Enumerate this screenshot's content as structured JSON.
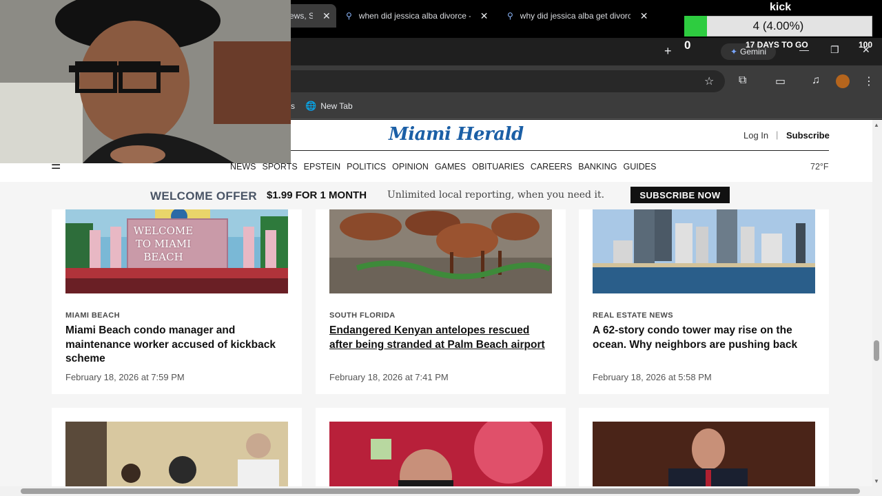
{
  "browser": {
    "tabs": [
      {
        "title": "ews, S",
        "active": true
      },
      {
        "title": "when did jessica alba divorce -",
        "active": false
      },
      {
        "title": "why did jessica alba get divorce",
        "active": false
      }
    ],
    "gemini_label": "Gemini",
    "bookmark_fragment": "s",
    "bookmark_new_tab": "New Tab"
  },
  "site": {
    "logo": "Miami Herald",
    "login": "Log In",
    "separator": "|",
    "subscribe": "Subscribe",
    "nav": [
      "NEWS",
      "SPORTS",
      "EPSTEIN",
      "POLITICS",
      "OPINION",
      "GAMES",
      "OBITUARIES",
      "CAREERS",
      "BANKING",
      "GUIDES"
    ],
    "temperature": "72°F"
  },
  "offer": {
    "label": "WELCOME OFFER",
    "price": "$1.99 FOR 1 MONTH",
    "text": "Unlimited local reporting, when you need it.",
    "button": "SUBSCRIBE NOW"
  },
  "articles": [
    {
      "kicker": "MIAMI BEACH",
      "headline": "Miami Beach condo manager and maintenance worker accused of kickback scheme",
      "date": "February 18, 2026 at 7:59 PM",
      "image_text": "WELCOME TO MIAMI BEACH"
    },
    {
      "kicker": "SOUTH FLORIDA",
      "headline": "Endangered Kenyan antelopes rescued after being stranded at Palm Beach airport",
      "date": "February 18, 2026 at 7:41 PM"
    },
    {
      "kicker": "REAL ESTATE NEWS",
      "headline": "A 62-story condo tower may rise on the ocean. Why neighbors are pushing back",
      "date": "February 18, 2026 at 5:58 PM"
    }
  ],
  "kick_overlay": {
    "title": "kick",
    "progress_text": "4 (4.00%)",
    "progress_value": 4,
    "progress_fraction": 0.04,
    "min": "0",
    "max": "100",
    "days": "17 DAYS TO GO",
    "accent": "#2ecc40"
  },
  "colors": {
    "chrome_dark": "#1f1f1f",
    "herald_blue": "#1b5fa6"
  }
}
